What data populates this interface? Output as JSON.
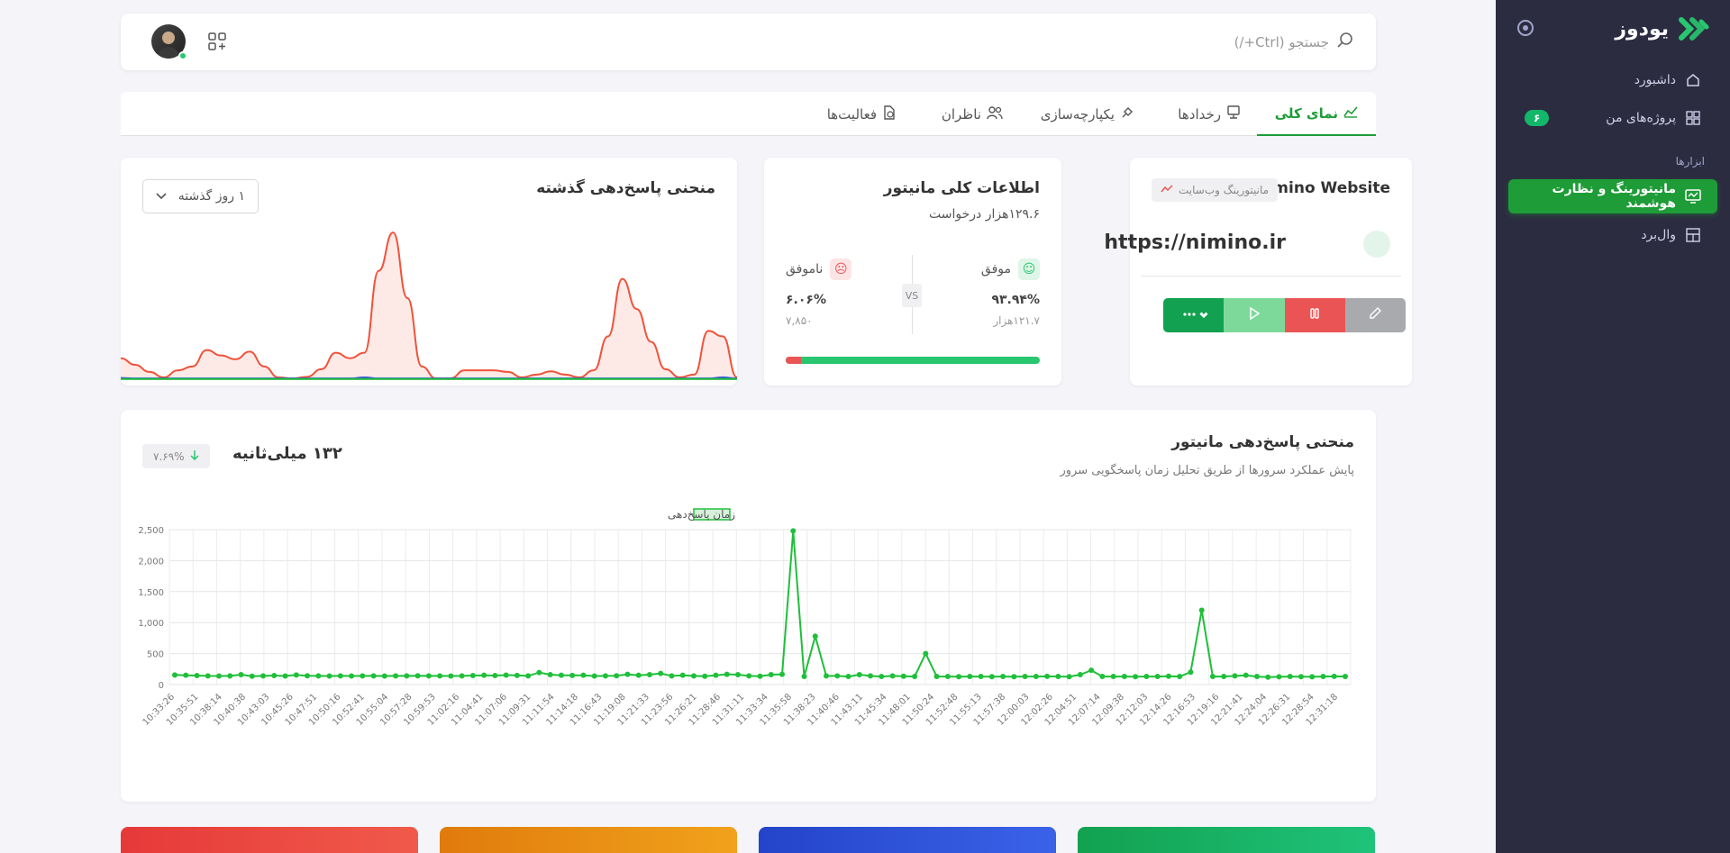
{
  "sidebar": {
    "brand": "یودوز",
    "items": [
      {
        "label": "داشبورد",
        "icon": "home-icon"
      },
      {
        "label": "پروژه‌های من",
        "icon": "grid-icon",
        "badge": "۶"
      }
    ],
    "section": "ابزارها",
    "tools": [
      {
        "label": "مانیتورینگ و نظارت هوشمند",
        "icon": "monitor-icon",
        "active": true
      },
      {
        "label": "وال‌برد",
        "icon": "board-icon"
      }
    ]
  },
  "topbar": {
    "search_placeholder": "جستجو (Ctrl+/)"
  },
  "tabs": [
    {
      "label": "نمای کلی",
      "active": true
    },
    {
      "label": "رخدادها"
    },
    {
      "label": "یکپارچه‌سازی"
    },
    {
      "label": "ناظران"
    },
    {
      "label": "فعالیت‌ها"
    }
  ],
  "site": {
    "name": "Nimino Website",
    "tag": "مانیتورینگ وب‌سایت",
    "url": "https://nimino.ir"
  },
  "overview": {
    "title": "اطلاعات کلی مانیتور",
    "requests": "۱۲۹.۶هزار درخواست",
    "ok_label": "موفق",
    "ok_pct": "۹۳.۹۴%",
    "ok_count": "۱۲۱.۷هزار",
    "fail_label": "ناموفق",
    "fail_pct": "۶.۰۶%",
    "fail_count": "۷,۸۵۰",
    "vs": "VS",
    "fail_fraction": 0.0606
  },
  "resp_card": {
    "title": "منحنی پاسخ‌دهی گذشته",
    "range": "۱ روز گذشته"
  },
  "main_chart_card": {
    "title": "منحنی پاسخ‌دهی مانیتور",
    "subtitle": "پایش عملکرد سرورها از طریق تحلیل زمان پاسخگویی سرور",
    "value": "۱۳۲ میلی‌ثانیه",
    "delta": "۷.۶۹%"
  },
  "chart_data": [
    {
      "type": "line",
      "series": [
        {
          "name": "زمان پاسخ‌دهی",
          "color": "#1fbf3a",
          "values": [
            155,
            150,
            145,
            140,
            138,
            140,
            160,
            135,
            140,
            145,
            138,
            155,
            142,
            140,
            138,
            140,
            138,
            140,
            140,
            138,
            140,
            140,
            142,
            140,
            140,
            138,
            140,
            145,
            150,
            145,
            152,
            148,
            140,
            195,
            160,
            150,
            148,
            150,
            138,
            140,
            142,
            165,
            150,
            160,
            180,
            140,
            150,
            140,
            135,
            150,
            165,
            160,
            140,
            135,
            160,
            165,
            2480,
            130,
            780,
            140,
            140,
            130,
            160,
            140,
            130,
            140,
            135,
            130,
            500,
            130,
            130,
            128,
            130,
            130,
            128,
            130,
            128,
            130,
            130,
            132,
            130,
            128,
            160,
            230,
            130,
            130,
            130,
            128,
            130,
            130,
            135,
            130,
            200,
            1200,
            130,
            130,
            140,
            150,
            130,
            120,
            125,
            130,
            128,
            125,
            130,
            132,
            130
          ]
        }
      ],
      "x_ticks": [
        "10:33:26",
        "10:35:51",
        "10:38:14",
        "10:40:38",
        "10:43:03",
        "10:45:26",
        "10:47:51",
        "10:50:16",
        "10:52:41",
        "10:55:04",
        "10:57:28",
        "10:59:53",
        "11:02:16",
        "11:04:41",
        "11:07:06",
        "11:09:31",
        "11:11:54",
        "11:14:18",
        "11:16:43",
        "11:19:08",
        "11:21:33",
        "11:23:56",
        "11:26:21",
        "11:28:46",
        "11:31:11",
        "11:33:34",
        "11:35:58",
        "11:38:23",
        "11:40:46",
        "11:43:11",
        "11:45:34",
        "11:48:01",
        "11:50:24",
        "11:52:48",
        "11:55:13",
        "11:57:38",
        "12:00:03",
        "12:02:26",
        "12:04:51",
        "12:07:14",
        "12:09:38",
        "12:12:03",
        "12:14:26",
        "12:16:53",
        "12:19:16",
        "12:21:41",
        "12:24:04",
        "12:26:31",
        "12:28:54",
        "12:31:18"
      ],
      "y_ticks": [
        "0",
        "500",
        "1,000",
        "1,500",
        "2,000",
        "2,500"
      ],
      "ylim": [
        0,
        2500
      ],
      "grid": true,
      "legend": "top-center"
    },
    {
      "type": "area",
      "series": [
        {
          "name": "",
          "color": "#f0523a",
          "values": [
            40,
            28,
            15,
            5,
            18,
            25,
            55,
            45,
            38,
            52,
            25,
            5,
            3,
            6,
            20,
            50,
            40,
            50,
            200,
            270,
            150,
            25,
            3,
            3,
            18,
            18,
            18,
            15,
            5,
            10,
            16,
            10,
            5,
            18,
            80,
            185,
            130,
            70,
            20,
            5,
            10,
            90,
            80,
            5
          ]
        },
        {
          "name": "",
          "color": "#3a55d6",
          "values": [
            4,
            3,
            3,
            3,
            3,
            3,
            3,
            3,
            3,
            3,
            3,
            3,
            3,
            3,
            3,
            3,
            3,
            5,
            3,
            3,
            3,
            3,
            3,
            3,
            3,
            3,
            3,
            3,
            3,
            3,
            3,
            3,
            3,
            3,
            3,
            3,
            3,
            3,
            3,
            3,
            3,
            3,
            5,
            3
          ]
        },
        {
          "name": "",
          "color": "#1fbf3a",
          "values": [
            2,
            2,
            2,
            2,
            2,
            2,
            2,
            2,
            2,
            2,
            2,
            2,
            2,
            2,
            2,
            2,
            2,
            2,
            2,
            2,
            2,
            2,
            2,
            2,
            2,
            2,
            2,
            2,
            2,
            2,
            2,
            2,
            2,
            2,
            2,
            2,
            2,
            2,
            2,
            2,
            2,
            2,
            2,
            2
          ]
        }
      ]
    }
  ],
  "colors": {
    "accent": "#1e9c37",
    "sidebar": "#2b2c40",
    "danger": "#ea5455",
    "success": "#28c76f"
  }
}
